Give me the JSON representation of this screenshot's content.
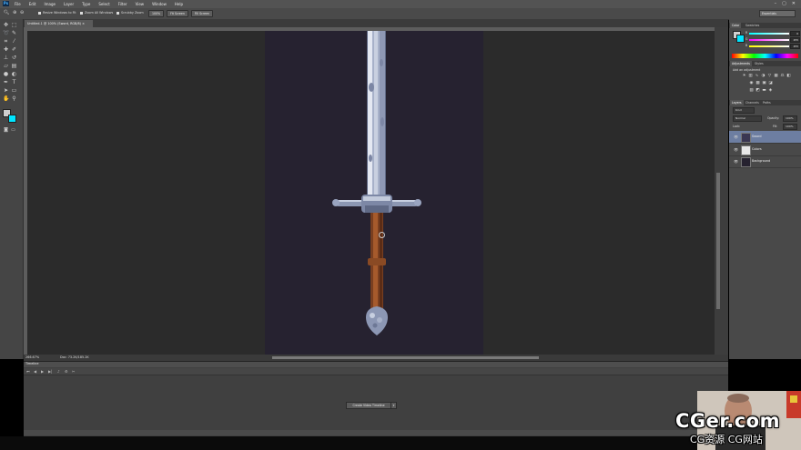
{
  "app": {
    "logo": "Ps"
  },
  "menu": [
    "File",
    "Edit",
    "Image",
    "Layer",
    "Type",
    "Select",
    "Filter",
    "View",
    "Window",
    "Help"
  ],
  "window_controls": [
    "–",
    "▢",
    "✕"
  ],
  "options_bar": {
    "resize_windows": "Resize Windows to Fit",
    "zoom_all": "Zoom All Windows",
    "scrubby": "Scrubby Zoom",
    "btn_100": "100%",
    "fit_screen": "Fit Screen",
    "fill_screen": "Fill Screen",
    "workspace": "Essentials"
  },
  "document": {
    "tab_title": "Untitled-1 @ 100% (Sword, RGB/8)",
    "close": "×"
  },
  "status": {
    "zoom": "266.67%",
    "doc": "Doc: 73.2K/185.2K"
  },
  "timeline": {
    "title": "Timeline",
    "create_button": "Create Video Timeline",
    "dropdown": "▾"
  },
  "color_panel": {
    "tabs": [
      "Color",
      "Swatches"
    ],
    "r_label": "R",
    "g_label": "G",
    "b_label": "B",
    "r": "0",
    "g": "255",
    "b": "255"
  },
  "adjustments": {
    "tabs": [
      "Adjustments",
      "Styles"
    ],
    "title": "Add an adjustment"
  },
  "layers": {
    "tabs": [
      "Layers",
      "Channels",
      "Paths"
    ],
    "kind": "Kind",
    "blend": "Normal",
    "opacity_label": "Opacity:",
    "opacity": "100%",
    "lock_label": "Lock:",
    "fill_label": "Fill:",
    "fill": "100%",
    "items": [
      {
        "name": "Sword",
        "selected": true
      },
      {
        "name": "Colors",
        "selected": false
      },
      {
        "name": "Background",
        "selected": false
      }
    ]
  },
  "watermark": {
    "main": "CGer.com",
    "sub": "CG资源 CG网站"
  },
  "colors": {
    "canvas_bg": "#262230",
    "foreground": "#cfcfcf",
    "background": "#00e5ff",
    "layer_selected": "#6d7ea1"
  }
}
